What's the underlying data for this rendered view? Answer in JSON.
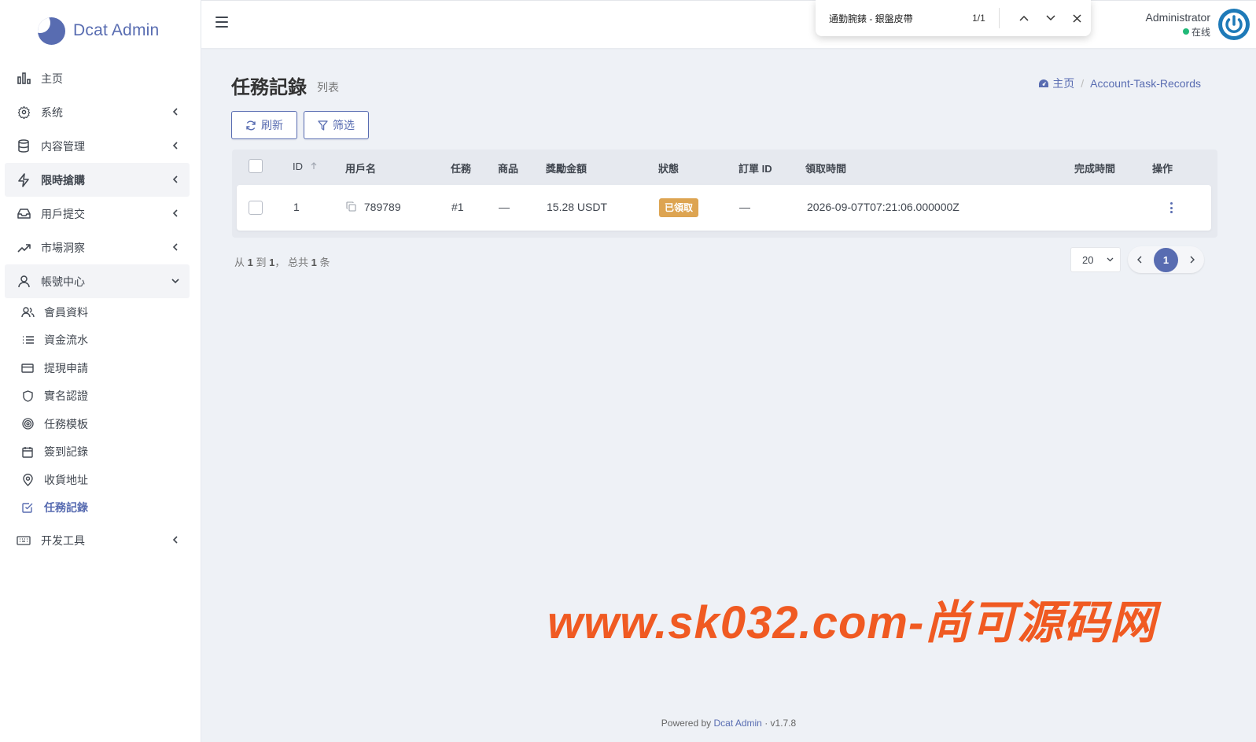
{
  "brand": {
    "name": "Dcat Admin"
  },
  "sidebar": {
    "menu": [
      {
        "label": "主页",
        "icon": "bar-chart-icon",
        "has_arrow": false
      },
      {
        "label": "系统",
        "icon": "gear-icon",
        "has_arrow": true
      },
      {
        "label": "内容管理",
        "icon": "database-icon",
        "has_arrow": true
      },
      {
        "label": "限時搶購",
        "icon": "lightning-icon",
        "has_arrow": true
      },
      {
        "label": "用戶提交",
        "icon": "inbox-icon",
        "has_arrow": true
      },
      {
        "label": "市場洞察",
        "icon": "trending-up-icon",
        "has_arrow": true
      },
      {
        "label": "帳號中心",
        "icon": "user-icon",
        "has_arrow": true,
        "expanded": true
      }
    ],
    "submenu": [
      {
        "label": "會員資料",
        "icon": "users-icon"
      },
      {
        "label": "資金流水",
        "icon": "list-icon"
      },
      {
        "label": "提現申請",
        "icon": "credit-card-icon"
      },
      {
        "label": "實名認證",
        "icon": "shield-icon"
      },
      {
        "label": "任務模板",
        "icon": "target-icon"
      },
      {
        "label": "簽到記錄",
        "icon": "calendar-icon"
      },
      {
        "label": "收貨地址",
        "icon": "map-pin-icon"
      },
      {
        "label": "任務記錄",
        "icon": "check-square-icon",
        "current": true
      }
    ],
    "devtools": {
      "label": "开发工具",
      "icon": "keyboard-icon"
    }
  },
  "topbar": {
    "user_name": "Administrator",
    "user_status": "在线"
  },
  "findbar": {
    "query": "通勤腕錶 - 銀盤皮帶",
    "count": "1/1"
  },
  "page": {
    "title": "任務記錄",
    "subtitle": "列表",
    "breadcrumb_home": "主页",
    "breadcrumb_sep": "/",
    "breadcrumb_current": "Account-Task-Records"
  },
  "toolbar": {
    "refresh_label": "刷新",
    "filter_label": "筛选"
  },
  "table": {
    "columns": {
      "id": "ID",
      "username": "用戶名",
      "task": "任務",
      "product": "商品",
      "reward": "獎勵金額",
      "status": "狀態",
      "order_id": "訂單 ID",
      "claimed_at": "領取時間",
      "completed_at": "完成時間",
      "actions": "操作"
    },
    "rows": [
      {
        "id": "1",
        "username": "789789",
        "task": "#1",
        "product": "—",
        "reward": "15.28 USDT",
        "status": "已領取",
        "order_id": "—",
        "claimed_at": "2026-09-07T07:21:06.000000Z",
        "completed_at": ""
      }
    ]
  },
  "pagination": {
    "summary_from_label": "从",
    "from": "1",
    "to_label": "到",
    "to": "1",
    "total_label": "， 总共",
    "total": "1",
    "unit": "条",
    "per_page": "20",
    "current_page": "1"
  },
  "watermark": "www.sk032.com-尚可源码网",
  "footer": {
    "powered_by": "Powered by",
    "link": "Dcat Admin",
    "sep": "·",
    "version": "v1.7.8"
  },
  "colors": {
    "accent": "#586cb1",
    "status_badge": "#dda451",
    "online": "#21b978",
    "watermark": "#f05a22"
  }
}
